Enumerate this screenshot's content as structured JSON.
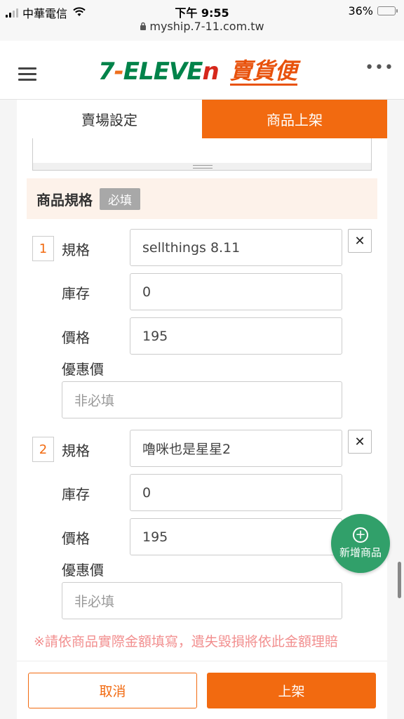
{
  "status_bar": {
    "carrier": "中華電信",
    "time": "下午 9:55",
    "battery": "36%",
    "battery_level": 0.36,
    "url": "myship.7-11.com.tw"
  },
  "header": {
    "logo_main_prefix": "7",
    "logo_main_dash": "-",
    "logo_main_mid": "ELEVE",
    "logo_main_n": "n",
    "logo_sub": "賣貨便"
  },
  "tabs": [
    {
      "label": "賣場設定",
      "active": false
    },
    {
      "label": "商品上架",
      "active": true
    }
  ],
  "spec_section": {
    "title": "商品規格",
    "badge": "必填",
    "labels": {
      "spec": "規格",
      "stock": "庫存",
      "price": "價格",
      "sale_price": "優惠價"
    },
    "remove_symbol": "✕",
    "items": [
      {
        "index": "1",
        "spec": "sellthings 8.11",
        "stock": "0",
        "price": "195",
        "sale_placeholder": "非必填"
      },
      {
        "index": "2",
        "spec": "嚕咪也是星星2",
        "stock": "0",
        "price": "195",
        "sale_placeholder": "非必填"
      }
    ]
  },
  "notice": "※請依商品實際金額填寫，遺失毀損將依此金額理賠",
  "fab": {
    "symbol": "+",
    "label": "新增商品"
  },
  "actions": {
    "cancel": "取消",
    "submit": "上架"
  },
  "colors": {
    "accent": "#f26a10",
    "brand_green": "#00834a",
    "fab_green": "#31a06a"
  }
}
